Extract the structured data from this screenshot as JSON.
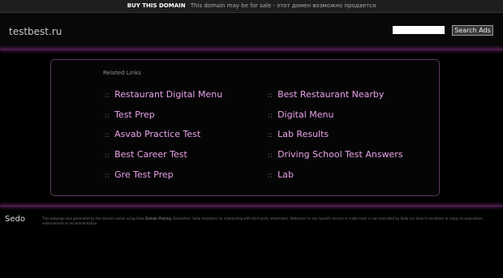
{
  "topbar": {
    "buy_label": "BUY THIS DOMAIN",
    "message": "This domain may be for sale - этот домен возможно продается"
  },
  "header": {
    "site_name": "testbest.ru",
    "search_placeholder": "",
    "search_button": "Search Ads"
  },
  "related": {
    "title": "Related Links",
    "bullet": "::",
    "left": [
      "Restaurant Digital Menu",
      "Test Prep",
      "Asvab Practice Test",
      "Best Career Test",
      "Gre Test Prep"
    ],
    "right": [
      "Best Restaurant Nearby",
      "Digital Menu",
      "Lab Results",
      "Driving School Test Answers",
      "Lab"
    ]
  },
  "footer": {
    "logo": "Sedo",
    "text_part1": "This webpage was generated by the domain owner using Sedo",
    "link": "Domain Parking",
    "text_part2": ". Disclaimer: Sedo maintains no relationship with third party advertisers. Reference to any specific service or trade mark is not controlled by Sedo nor does it constitute or imply its association, endorsement or recommendation."
  },
  "colors": {
    "accent": "#e9a3e9",
    "background": "#000000"
  }
}
